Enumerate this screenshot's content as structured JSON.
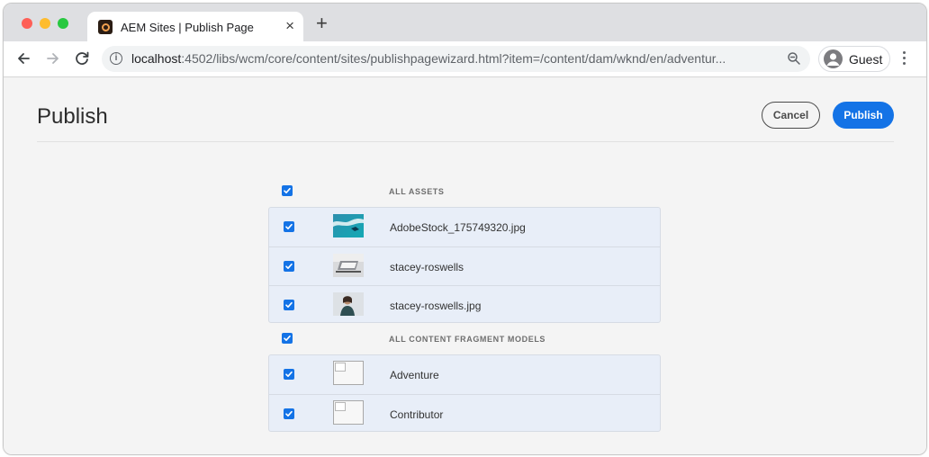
{
  "browser": {
    "tab_title": "AEM Sites | Publish Page",
    "new_tab_symbol": "+",
    "close_symbol": "×",
    "url_host": "localhost",
    "url_path": ":4502/libs/wcm/core/content/sites/publishpagewizard.html?item=/content/dam/wknd/en/adventur...",
    "profile_label": "Guest",
    "icons": [
      "back-icon",
      "forward-icon",
      "reload-icon",
      "info-icon",
      "zoom-icon",
      "avatar-icon",
      "kebab-menu-icon"
    ]
  },
  "page": {
    "title": "Publish",
    "cancel_label": "Cancel",
    "publish_label": "Publish",
    "accent_color": "#1473e6"
  },
  "groups": [
    {
      "label": "ALL ASSETS",
      "checked": true,
      "items": [
        {
          "name": "AdobeStock_175749320.jpg",
          "checked": true,
          "thumbnail": "ocean-aerial-image"
        },
        {
          "name": "stacey-roswells",
          "checked": true,
          "thumbnail": "laptop-desk-image"
        },
        {
          "name": "stacey-roswells.jpg",
          "checked": true,
          "thumbnail": "person-portrait-image"
        }
      ]
    },
    {
      "label": "ALL CONTENT FRAGMENT MODELS",
      "checked": true,
      "items": [
        {
          "name": "Adventure",
          "checked": true,
          "thumbnail": "broken-image"
        },
        {
          "name": "Contributor",
          "checked": true,
          "thumbnail": "broken-image"
        }
      ]
    }
  ]
}
